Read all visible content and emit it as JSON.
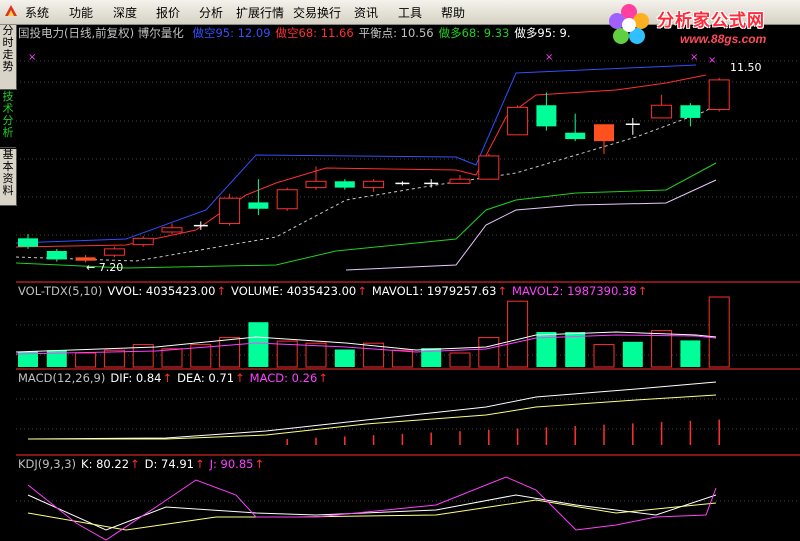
{
  "menu": [
    "系统",
    "功能",
    "深度",
    "报价",
    "分析",
    "扩展行情",
    "交易换行",
    "资讯",
    "工具",
    "帮助"
  ],
  "brand": {
    "name": "分析家公式网",
    "url": "www.88gs.com"
  },
  "sidetabs": [
    "分时走势",
    "技术分析",
    "基本资料"
  ],
  "main": {
    "stock": "国投电力(日线,前复权) 博尔量化",
    "items": [
      {
        "label": "做空95: 12.09",
        "color": "#3050ff"
      },
      {
        "label": "做空68: 11.66",
        "color": "#ff3030"
      },
      {
        "label": "平衡点: 10.56",
        "color": "#c0c0c0"
      },
      {
        "label": "做多68: 9.33",
        "color": "#20d020"
      },
      {
        "label": "做多95: 9.",
        "color": "#ffffff"
      }
    ],
    "high_label": "11.50",
    "low_label": "7.20"
  },
  "vol": {
    "items": [
      {
        "label": "VOL-TDX(5,10)",
        "color": "#c0c0c0"
      },
      {
        "label": "VVOL: 4035423.00",
        "color": "#ffffff"
      },
      {
        "label": "VOLUME: 4035423.00",
        "color": "#ffffff"
      },
      {
        "label": "MAVOL1: 1979257.63",
        "color": "#ffffff"
      },
      {
        "label": "MAVOL2: 1987390.38",
        "color": "#ff40ff"
      }
    ]
  },
  "macd": {
    "items": [
      {
        "label": "MACD(12,26,9)",
        "color": "#c0c0c0"
      },
      {
        "label": "DIF: 0.84",
        "color": "#ffffff"
      },
      {
        "label": "DEA: 0.71",
        "color": "#ffffff"
      },
      {
        "label": "MACD: 0.26",
        "color": "#ff40ff"
      }
    ]
  },
  "kdj": {
    "items": [
      {
        "label": "KDJ(9,3,3)",
        "color": "#c0c0c0"
      },
      {
        "label": "K: 80.22",
        "color": "#ffffff"
      },
      {
        "label": "D: 74.91",
        "color": "#ffffff"
      },
      {
        "label": "J: 90.85",
        "color": "#ff40ff"
      }
    ]
  },
  "colors": {
    "up": "#ff3030",
    "down": "#00ff99",
    "flat": "#ffffff",
    "special": "#ff5020"
  },
  "candles": [
    {
      "o": 7.75,
      "c": 7.55,
      "h": 7.85,
      "l": 7.5
    },
    {
      "o": 7.45,
      "c": 7.25,
      "h": 7.5,
      "l": 7.2
    },
    {
      "o": 7.22,
      "c": 7.3,
      "h": 7.35,
      "l": 7.18
    },
    {
      "o": 7.35,
      "c": 7.5,
      "h": 7.55,
      "l": 7.3
    },
    {
      "o": 7.6,
      "c": 7.75,
      "h": 7.8,
      "l": 7.55
    },
    {
      "o": 7.9,
      "c": 8.0,
      "h": 8.1,
      "l": 7.85
    },
    {
      "o": 8.05,
      "c": 8.05,
      "h": 8.15,
      "l": 7.95
    },
    {
      "o": 8.1,
      "c": 8.7,
      "h": 8.8,
      "l": 8.05
    },
    {
      "o": 8.6,
      "c": 8.45,
      "h": 9.15,
      "l": 8.3
    },
    {
      "o": 8.45,
      "c": 8.9,
      "h": 8.95,
      "l": 8.4
    },
    {
      "o": 8.95,
      "c": 9.1,
      "h": 9.45,
      "l": 8.9
    },
    {
      "o": 9.1,
      "c": 8.95,
      "h": 9.15,
      "l": 8.9
    },
    {
      "o": 8.95,
      "c": 9.1,
      "h": 9.15,
      "l": 8.85
    },
    {
      "o": 9.05,
      "c": 9.05,
      "h": 9.1,
      "l": 9.0
    },
    {
      "o": 9.05,
      "c": 9.05,
      "h": 9.15,
      "l": 8.95
    },
    {
      "o": 9.05,
      "c": 9.15,
      "h": 9.25,
      "l": 9.05
    },
    {
      "o": 9.15,
      "c": 9.7,
      "h": 9.75,
      "l": 9.15
    },
    {
      "o": 10.2,
      "c": 10.85,
      "h": 10.9,
      "l": 10.2
    },
    {
      "o": 10.9,
      "c": 10.4,
      "h": 11.2,
      "l": 10.3
    },
    {
      "o": 10.25,
      "c": 10.1,
      "h": 10.7,
      "l": 10.05
    },
    {
      "o": 10.45,
      "c": 10.05,
      "h": 10.45,
      "l": 9.75
    },
    {
      "o": 10.45,
      "c": 10.45,
      "h": 10.6,
      "l": 10.2
    },
    {
      "o": 10.6,
      "c": 10.9,
      "h": 11.15,
      "l": 10.6
    },
    {
      "o": 10.9,
      "c": 10.6,
      "h": 10.95,
      "l": 10.4
    },
    {
      "o": 10.8,
      "c": 11.5,
      "h": 11.55,
      "l": 10.75
    }
  ],
  "candle_types": [
    "d",
    "d",
    "s",
    "u",
    "u",
    "u",
    "f",
    "u",
    "d",
    "u",
    "u",
    "d",
    "u",
    "f",
    "f",
    "u",
    "u",
    "u",
    "d",
    "d",
    "s",
    "f",
    "u",
    "d",
    "u"
  ],
  "volumes": [
    {
      "v": 0.22,
      "t": "d"
    },
    {
      "v": 0.24,
      "t": "d"
    },
    {
      "v": 0.2,
      "t": "u"
    },
    {
      "v": 0.24,
      "t": "u"
    },
    {
      "v": 0.32,
      "t": "u"
    },
    {
      "v": 0.26,
      "t": "u"
    },
    {
      "v": 0.32,
      "t": "u"
    },
    {
      "v": 0.42,
      "t": "u"
    },
    {
      "v": 0.64,
      "t": "d"
    },
    {
      "v": 0.37,
      "t": "u"
    },
    {
      "v": 0.34,
      "t": "u"
    },
    {
      "v": 0.25,
      "t": "d"
    },
    {
      "v": 0.34,
      "t": "u"
    },
    {
      "v": 0.24,
      "t": "u"
    },
    {
      "v": 0.27,
      "t": "d"
    },
    {
      "v": 0.2,
      "t": "u"
    },
    {
      "v": 0.42,
      "t": "u"
    },
    {
      "v": 0.94,
      "t": "u"
    },
    {
      "v": 0.5,
      "t": "d"
    },
    {
      "v": 0.5,
      "t": "d"
    },
    {
      "v": 0.32,
      "t": "u"
    },
    {
      "v": 0.36,
      "t": "d"
    },
    {
      "v": 0.52,
      "t": "u"
    },
    {
      "v": 0.38,
      "t": "d"
    },
    {
      "v": 1.0,
      "t": "u"
    }
  ]
}
